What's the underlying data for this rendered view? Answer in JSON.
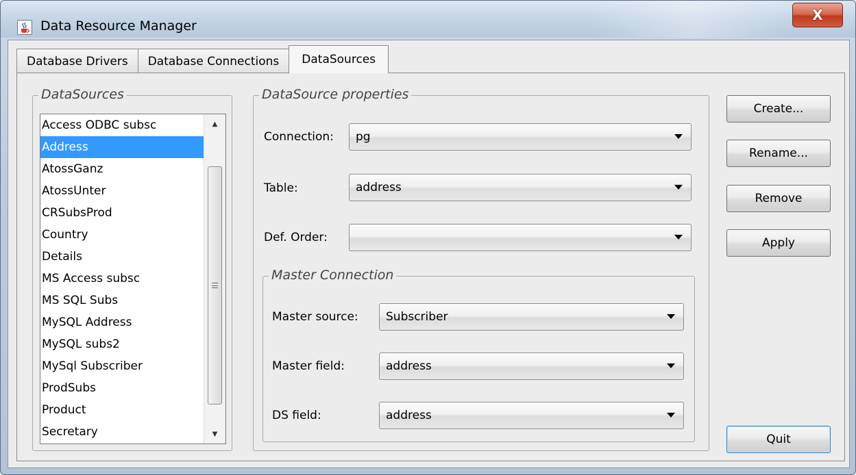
{
  "window": {
    "title": "Data Resource Manager",
    "close_glyph": "X",
    "app_icon": "java-cup-icon"
  },
  "tabs": [
    {
      "label": "Database Drivers",
      "active": false
    },
    {
      "label": "Database Connections",
      "active": false
    },
    {
      "label": "DataSources",
      "active": true
    }
  ],
  "datasources": {
    "group_title": "DataSources",
    "selected": "Address",
    "items": [
      "Access ODBC subsc",
      "Address",
      "AtossGanz",
      "AtossUnter",
      "CRSubsProd",
      "Country",
      "Details",
      "MS Access subsc",
      "MS SQL Subs",
      "MySQL Address",
      "MySQL subs2",
      "MySql Subscriber",
      "ProdSubs",
      "Product",
      "Secretary"
    ]
  },
  "properties": {
    "group_title": "DataSource properties",
    "connection_label": "Connection:",
    "connection_value": "pg",
    "table_label": "Table:",
    "table_value": "address",
    "order_label": "Def. Order:",
    "order_value": "",
    "master": {
      "group_title": "Master Connection",
      "source_label": "Master source:",
      "source_value": "Subscriber",
      "field_label": "Master field:",
      "field_value": "address",
      "ds_field_label": "DS field:",
      "ds_field_value": "address"
    }
  },
  "buttons": {
    "create": "Create...",
    "rename": "Rename...",
    "remove": "Remove",
    "apply": "Apply",
    "quit": "Quit"
  },
  "colors": {
    "selection": "#3399ff",
    "close_button": "#c0391f"
  }
}
